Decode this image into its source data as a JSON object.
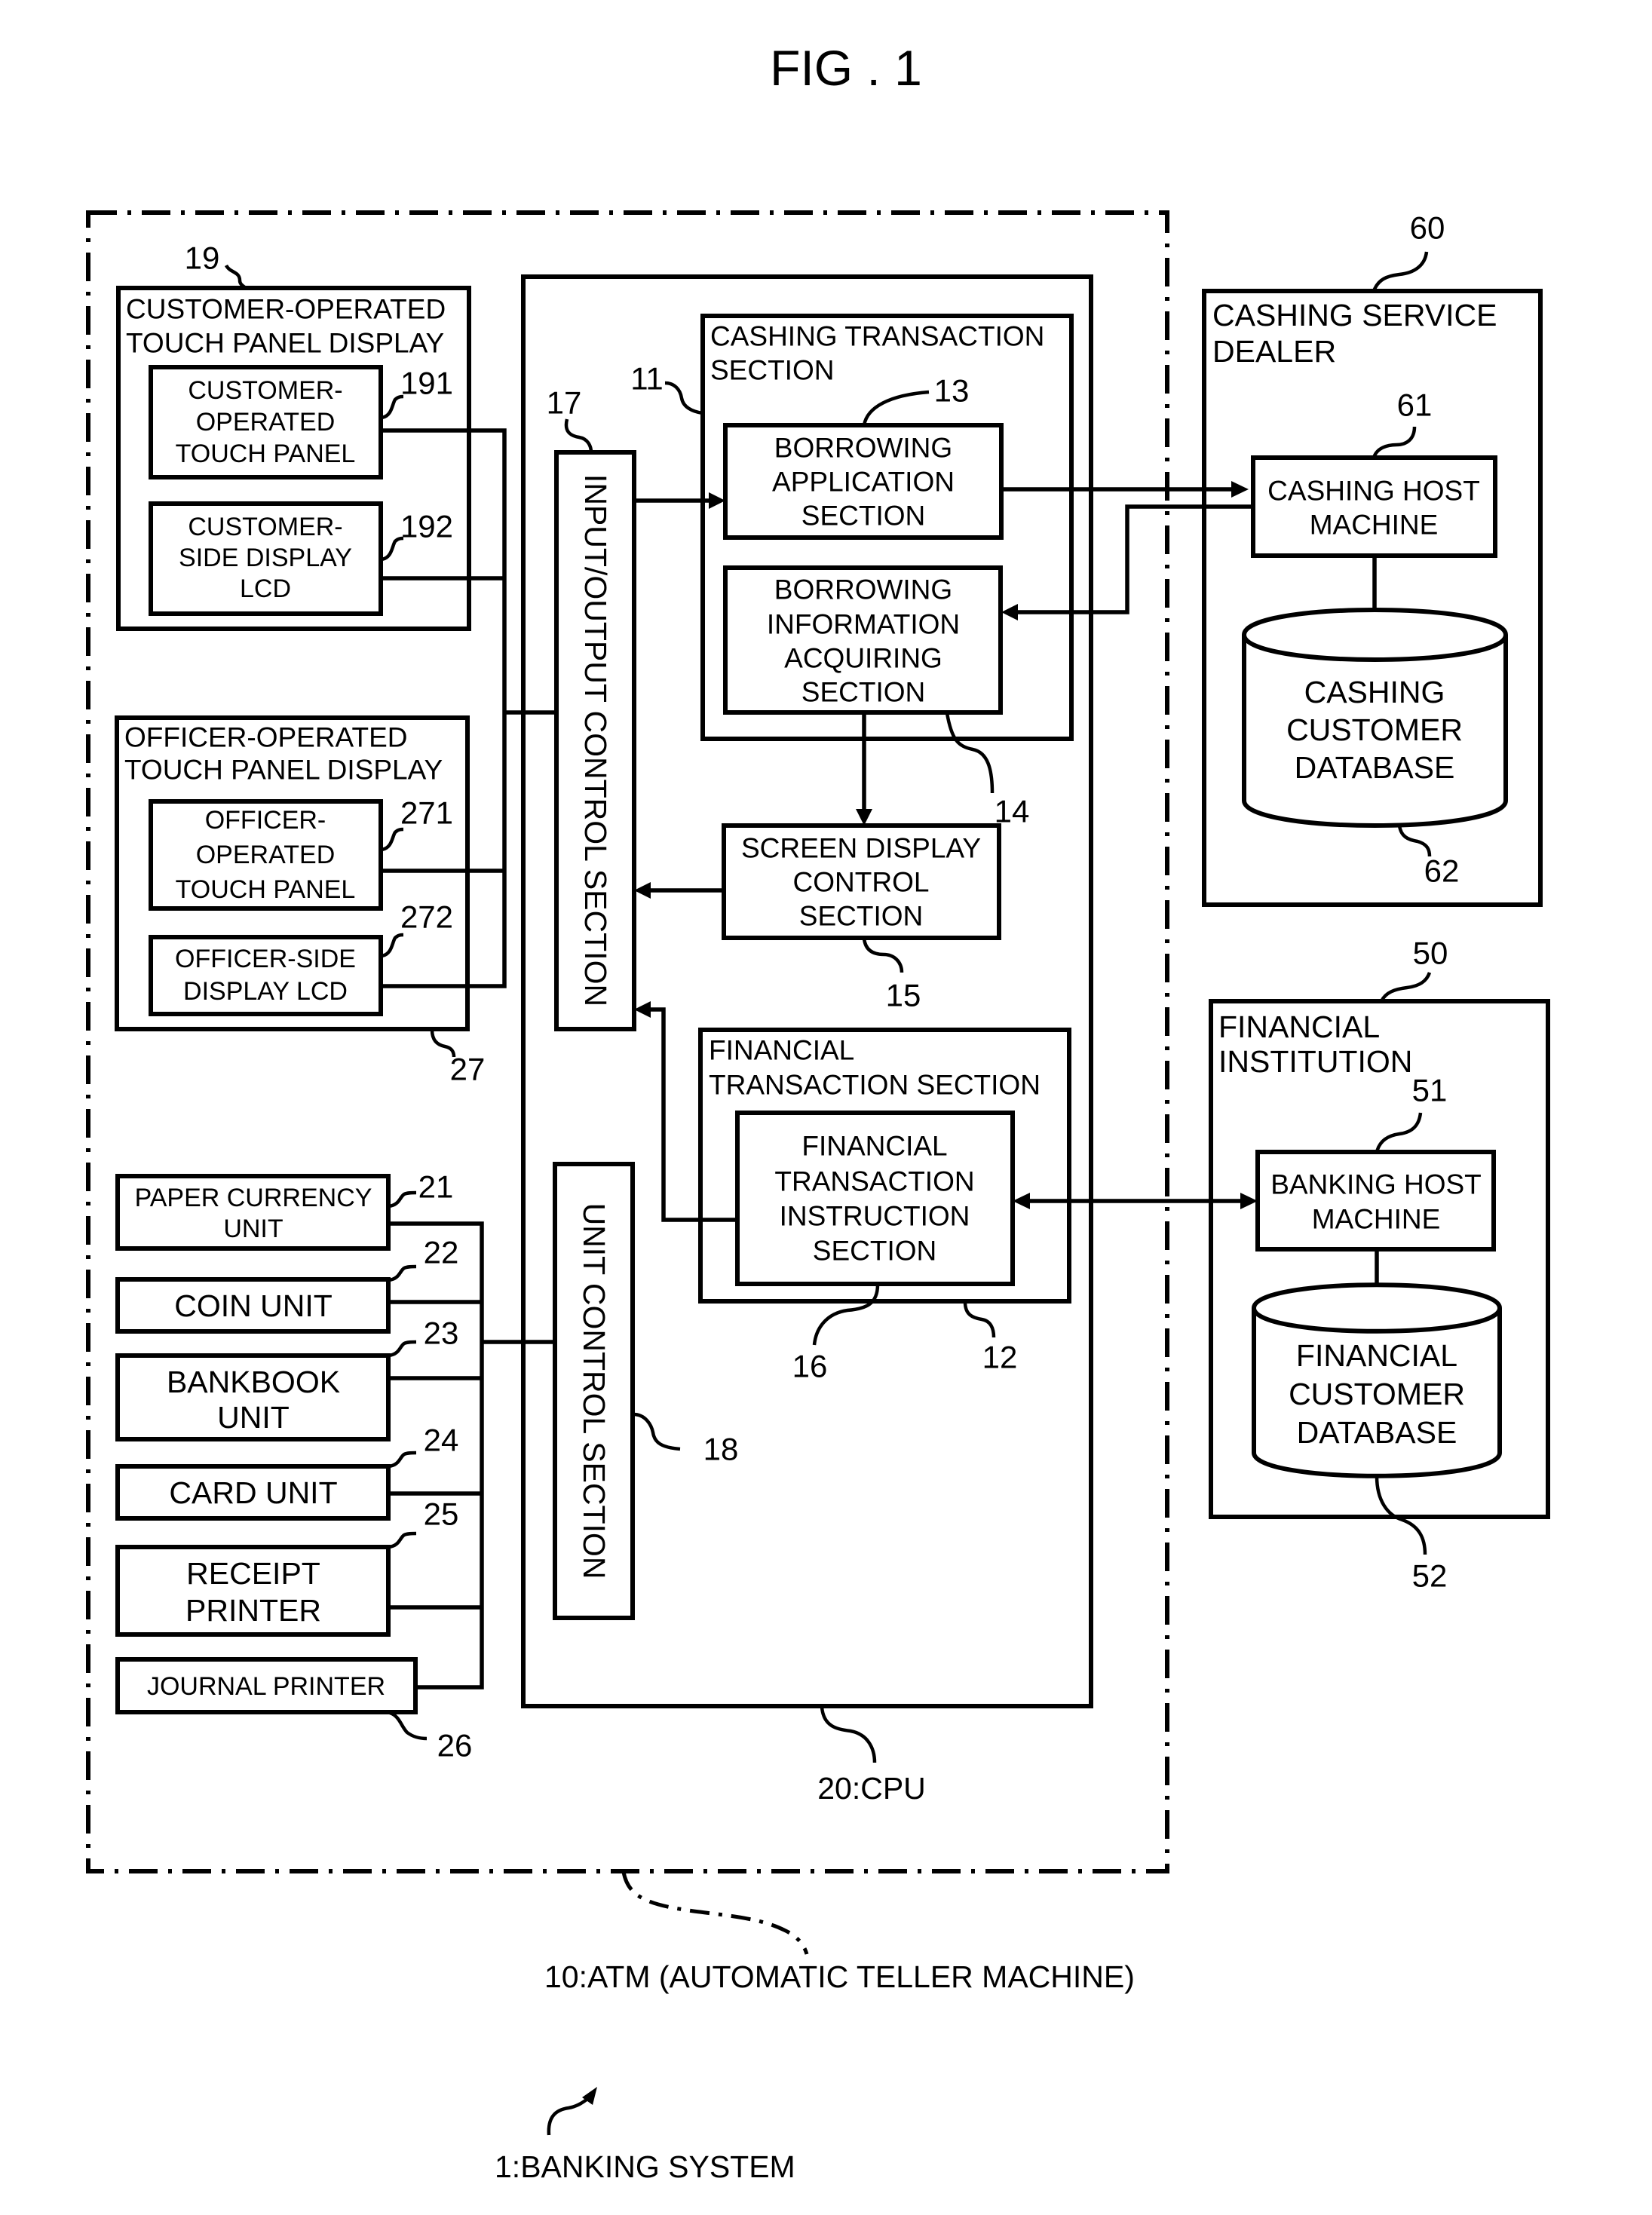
{
  "figure": {
    "title": "FIG . 1",
    "system_label": "1:BANKING SYSTEM",
    "atm_label": "10:ATM (AUTOMATIC TELLER MACHINE)",
    "cpu_label": "20:CPU"
  },
  "atm": {
    "customer_display": {
      "ref": "19",
      "title": [
        "CUSTOMER-OPERATED",
        "TOUCH PANEL DISPLAY"
      ],
      "touch_panel": {
        "ref": "191",
        "lines": [
          "CUSTOMER-",
          "OPERATED",
          "TOUCH PANEL"
        ]
      },
      "lcd": {
        "ref": "192",
        "lines": [
          "CUSTOMER-",
          "SIDE DISPLAY",
          "LCD"
        ]
      }
    },
    "officer_display": {
      "ref": "27",
      "title": [
        "OFFICER-OPERATED",
        "TOUCH PANEL DISPLAY"
      ],
      "touch_panel": {
        "ref": "271",
        "lines": [
          "OFFICER-",
          "OPERATED",
          "TOUCH PANEL"
        ]
      },
      "lcd": {
        "ref": "272",
        "lines": [
          "OFFICER-SIDE",
          "DISPLAY LCD"
        ]
      }
    },
    "units": [
      {
        "ref": "21",
        "lines": [
          "PAPER CURRENCY",
          "UNIT"
        ]
      },
      {
        "ref": "22",
        "lines": [
          "COIN UNIT"
        ]
      },
      {
        "ref": "23",
        "lines": [
          "BANKBOOK",
          "UNIT"
        ]
      },
      {
        "ref": "24",
        "lines": [
          "CARD UNIT"
        ]
      },
      {
        "ref": "25",
        "lines": [
          "RECEIPT",
          "PRINTER"
        ]
      },
      {
        "ref": "26",
        "lines": [
          "JOURNAL PRINTER"
        ]
      }
    ],
    "cpu": {
      "io_control": {
        "ref": "17",
        "label": "INPUT/OUTPUT CONTROL SECTION"
      },
      "unit_control": {
        "ref": "18",
        "label": "UNIT CONTROL SECTION"
      },
      "cashing_transaction": {
        "ref": "11",
        "title": [
          "CASHING TRANSACTION",
          "SECTION"
        ],
        "borrowing_application": {
          "ref": "13",
          "lines": [
            "BORROWING",
            "APPLICATION",
            "SECTION"
          ]
        },
        "borrowing_information": {
          "ref": "14",
          "lines": [
            "BORROWING",
            "INFORMATION",
            "ACQUIRING",
            "SECTION"
          ]
        }
      },
      "screen_display": {
        "ref": "15",
        "lines": [
          "SCREEN DISPLAY",
          "CONTROL",
          "SECTION"
        ]
      },
      "financial_transaction": {
        "ref": "12",
        "title": [
          "FINANCIAL",
          "TRANSACTION SECTION"
        ],
        "instruction": {
          "ref": "16",
          "lines": [
            "FINANCIAL",
            "TRANSACTION",
            "INSTRUCTION",
            "SECTION"
          ]
        }
      }
    }
  },
  "cashing_service_dealer": {
    "ref": "60",
    "title": [
      "CASHING SERVICE",
      "DEALER"
    ],
    "host": {
      "ref": "61",
      "lines": [
        "CASHING HOST",
        "MACHINE"
      ]
    },
    "database": {
      "ref": "62",
      "lines": [
        "CASHING",
        "CUSTOMER",
        "DATABASE"
      ]
    }
  },
  "financial_institution": {
    "ref": "50",
    "title": [
      "FINANCIAL",
      "INSTITUTION"
    ],
    "host": {
      "ref": "51",
      "lines": [
        "BANKING HOST",
        "MACHINE"
      ]
    },
    "database": {
      "ref": "52",
      "lines": [
        "FINANCIAL",
        "CUSTOMER",
        "DATABASE"
      ]
    }
  }
}
